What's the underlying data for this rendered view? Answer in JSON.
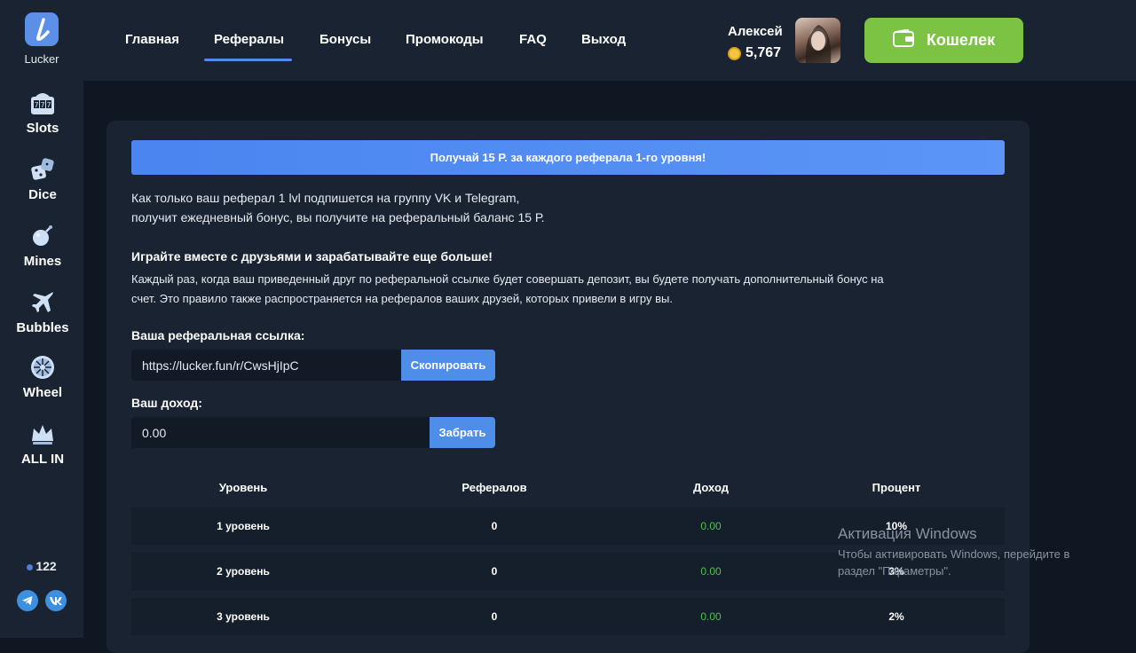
{
  "app": {
    "logo_text": "Lucker"
  },
  "sidebar": {
    "items": [
      {
        "label": "Slots",
        "icon": "slot-machine-icon"
      },
      {
        "label": "Dice",
        "icon": "dice-icon"
      },
      {
        "label": "Mines",
        "icon": "bomb-icon"
      },
      {
        "label": "Bubbles",
        "icon": "plane-icon"
      },
      {
        "label": "Wheel",
        "icon": "wheel-icon"
      },
      {
        "label": "ALL IN",
        "icon": "crown-icon"
      }
    ],
    "online_count": "122",
    "social": [
      "telegram-icon",
      "vk-icon"
    ]
  },
  "header": {
    "menu": [
      "Главная",
      "Рефералы",
      "Бонусы",
      "Промокоды",
      "FAQ",
      "Выход"
    ],
    "active_menu": "Рефералы",
    "user_name": "Алексей",
    "balance": "5,767",
    "wallet_label": "Кошелек"
  },
  "referral": {
    "banner": "Получай 15 Р. за каждого реферала 1-го уровня!",
    "intro_line1": "Как только ваш реферал 1 lvl подпишется на группу VK и Telegram,",
    "intro_line2": "получит ежедневный бонус, вы получите на реферальный баланс 15 Р.",
    "heading": "Играйте вместе с друзьями и зарабатывайте еще больше!",
    "desc_line1": "Каждый раз, когда ваш приведенный друг по реферальной ссылке будет совершать депозит, вы будете получать дополнительный бонус на",
    "desc_line2": "счет. Это правило также распространяется на рефералов ваших друзей, которых привели в игру вы.",
    "link_label": "Ваша реферальная ссылка:",
    "link_value": "https://lucker.fun/r/CwsHjIpC",
    "copy_button": "Скопировать",
    "income_label": "Ваш доход:",
    "income_value": "0.00",
    "claim_button": "Забрать"
  },
  "table": {
    "headers": [
      "Уровень",
      "Рефералов",
      "Доход",
      "Процент"
    ],
    "rows": [
      {
        "level": "1 уровень",
        "referrals": "0",
        "income": "0.00",
        "percent": "10%"
      },
      {
        "level": "2 уровень",
        "referrals": "0",
        "income": "0.00",
        "percent": "3%"
      },
      {
        "level": "3 уровень",
        "referrals": "0",
        "income": "0.00",
        "percent": "2%"
      }
    ]
  },
  "watermark": {
    "title": "Активация Windows",
    "line1": "Чтобы активировать Windows, перейдите в",
    "line2": "раздел \"Параметры\"."
  },
  "colors": {
    "accent": "#4f8ee8",
    "wallet": "#7cc243",
    "income_green": "#4ec24e",
    "background": "#0f1722",
    "panel": "#1a2332"
  }
}
